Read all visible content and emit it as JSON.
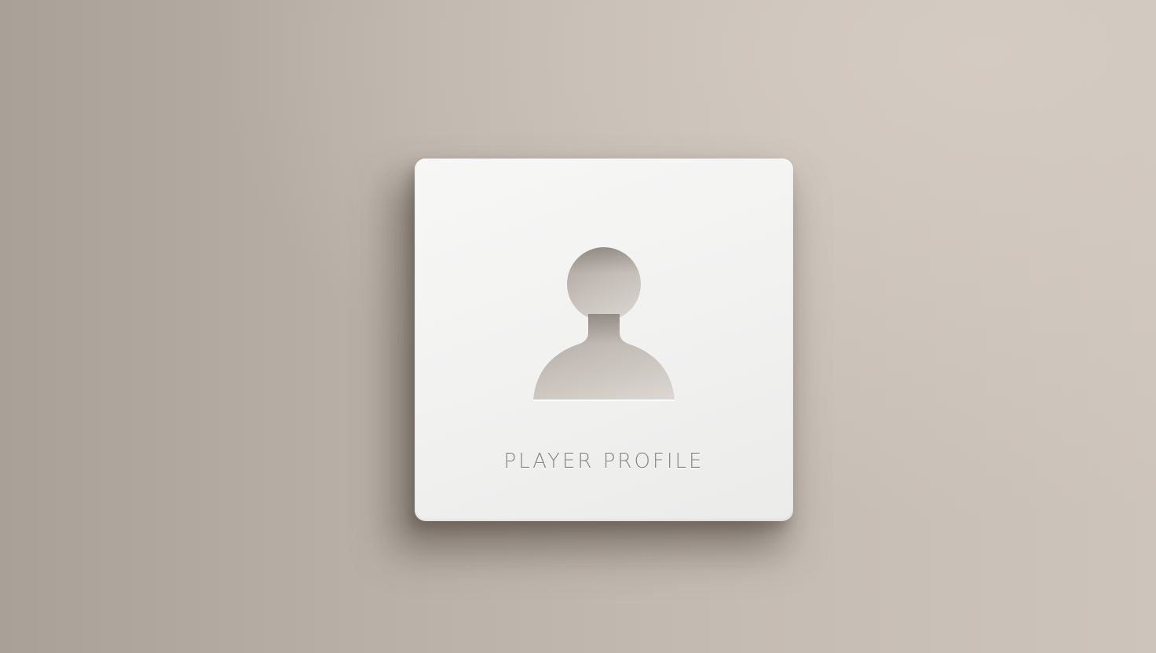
{
  "card": {
    "label": "PLAYER PROFILE",
    "icon": "user-silhouette-icon"
  },
  "colors": {
    "background": "#bdb4ab",
    "card": "#f3f3f2",
    "label": "#8a8986",
    "cutout": "#c9c3bd"
  }
}
